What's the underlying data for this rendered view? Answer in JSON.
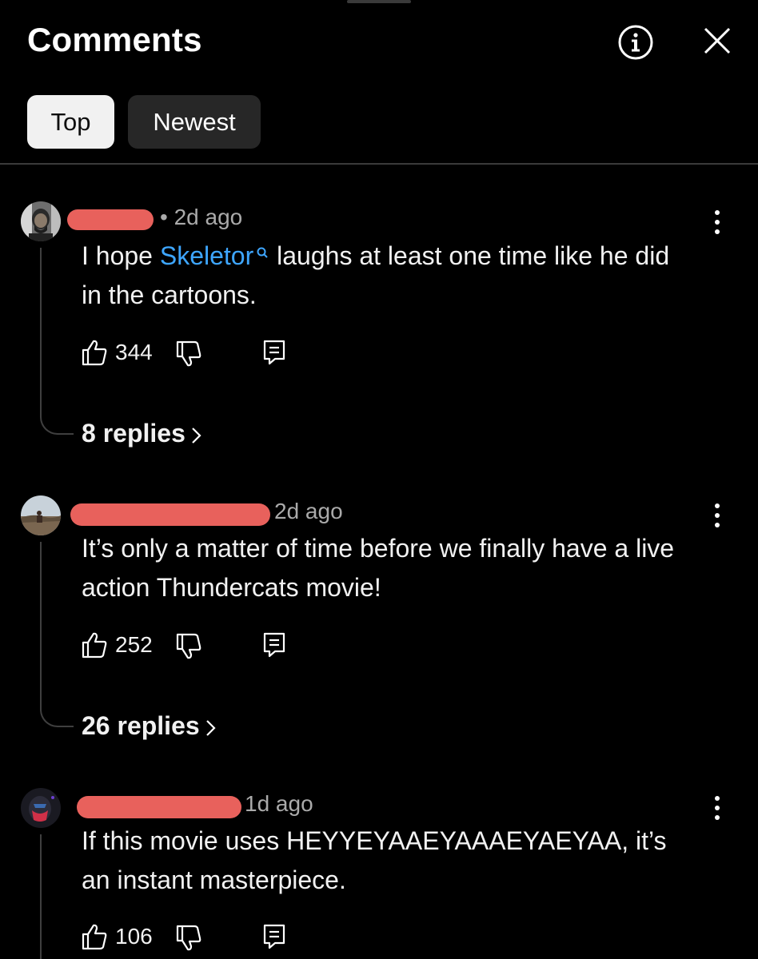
{
  "header": {
    "title": "Comments",
    "sort_chips": [
      {
        "label": "Top",
        "selected": true
      },
      {
        "label": "Newest",
        "selected": false
      }
    ]
  },
  "icons": {
    "info": "info-icon",
    "close": "close-icon",
    "more": "more-vert-icon",
    "like": "thumbs-up-icon",
    "dislike": "thumbs-down-icon",
    "reply": "reply-icon",
    "chevron": "chevron-right-icon"
  },
  "colors": {
    "background": "#000000",
    "link": "#3ea6ff",
    "redaction": "#e8615c",
    "chip_selected": "#f1f1f1",
    "chip_unselected": "#272727"
  },
  "comments": [
    {
      "timestamp": "• 2d ago",
      "text_before": "I hope ",
      "link_text": "Skeletor",
      "text_after": " laughs at least one time like he did in the cartoons.",
      "likes": "344",
      "replies_label": "8 replies"
    },
    {
      "timestamp": "2d ago",
      "text": "It’s only a matter of time before we finally have a live action Thundercats movie!",
      "likes": "252",
      "replies_label": "26 replies"
    },
    {
      "timestamp": "1d ago",
      "text": "If this movie uses HEYYEYAAEYAAAEYAEYAA, it’s an instant masterpiece.",
      "likes": "106"
    }
  ]
}
